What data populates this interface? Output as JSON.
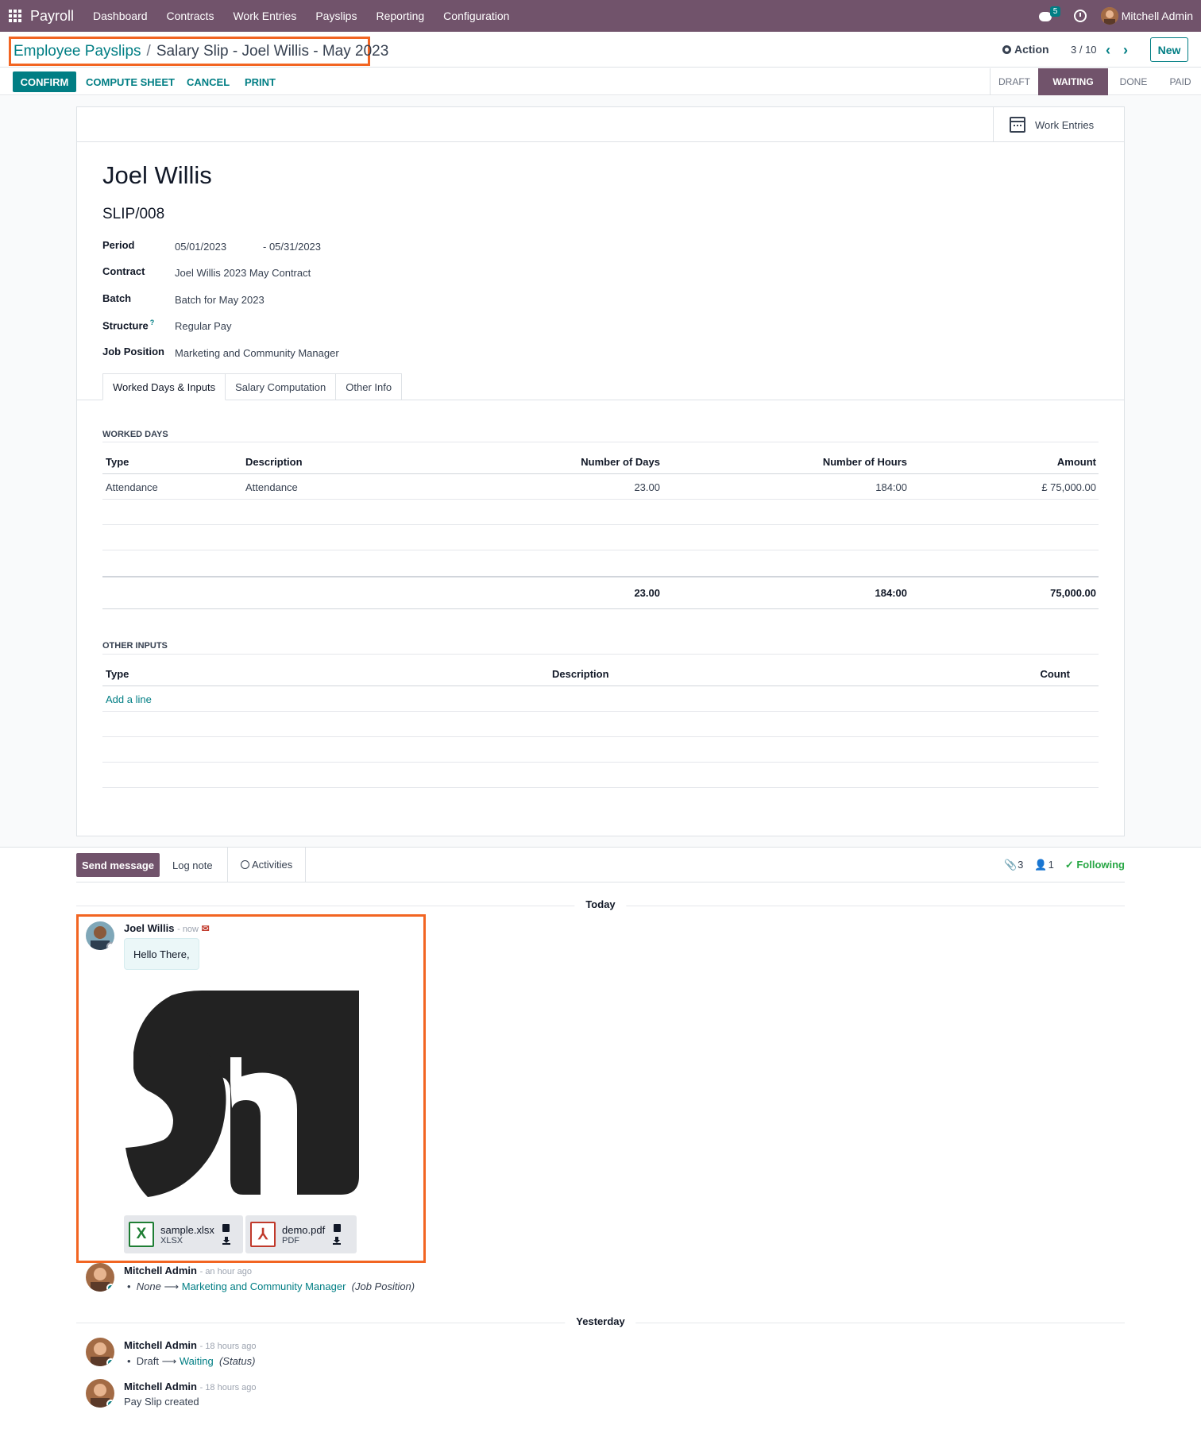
{
  "navbar": {
    "brand": "Payroll",
    "menu": [
      "Dashboard",
      "Contracts",
      "Work Entries",
      "Payslips",
      "Reporting",
      "Configuration"
    ],
    "chat_badge": "5",
    "user": "Mitchell Admin"
  },
  "control": {
    "breadcrumb_parent": "Employee Payslips",
    "breadcrumb_separator": "/",
    "breadcrumb_current": "Salary Slip - Joel Willis - May 2023",
    "action_label": "Action",
    "pager": "3 / 10",
    "new_label": "New"
  },
  "buttons": {
    "confirm": "CONFIRM",
    "compute": "COMPUTE SHEET",
    "cancel": "CANCEL",
    "print": "PRINT"
  },
  "status_steps": [
    "DRAFT",
    "WAITING",
    "DONE",
    "PAID"
  ],
  "status_active": "WAITING",
  "smart_button": "Work Entries",
  "form": {
    "employee": "Joel Willis",
    "reference": "SLIP/008",
    "period_label": "Period",
    "period_from": "05/01/2023",
    "period_to": "- 05/31/2023",
    "contract_label": "Contract",
    "contract": "Joel Willis 2023 May Contract",
    "batch_label": "Batch",
    "batch": "Batch for May 2023",
    "structure_label": "Structure",
    "structure_help": "?",
    "structure": "Regular Pay",
    "job_label": "Job Position",
    "job": "Marketing and Community Manager"
  },
  "tabs": [
    "Worked Days & Inputs",
    "Salary Computation",
    "Other Info"
  ],
  "worked_days": {
    "title": "WORKED DAYS",
    "columns": [
      "Type",
      "Description",
      "Number of Days",
      "Number of Hours",
      "Amount"
    ],
    "rows": [
      {
        "type": "Attendance",
        "description": "Attendance",
        "days": "23.00",
        "hours": "184:00",
        "amount": "£ 75,000.00"
      }
    ],
    "totals": {
      "days": "23.00",
      "hours": "184:00",
      "amount": "75,000.00"
    }
  },
  "other_inputs": {
    "title": "OTHER INPUTS",
    "columns": [
      "Type",
      "Description",
      "Count"
    ],
    "add_line": "Add a line"
  },
  "chatter": {
    "send_message": "Send message",
    "log_note": "Log note",
    "activities": "Activities",
    "attachments_count": "3",
    "followers_count": "1",
    "following": "Following"
  },
  "timeline": {
    "today": "Today",
    "yesterday": "Yesterday",
    "msg1": {
      "author": "Joel Willis",
      "when": "- now",
      "body": "Hello There,",
      "attachments": [
        {
          "name": "sample.xlsx",
          "ext": "XLSX",
          "icon": "X",
          "color": "#1e7e34"
        },
        {
          "name": "demo.pdf",
          "ext": "PDF",
          "icon": "⅄",
          "color": "#c0392b"
        }
      ]
    },
    "msg2": {
      "author": "Mitchell Admin",
      "when": "- an hour ago",
      "old": "None",
      "new": "Marketing and Community Manager",
      "field": "(Job Position)"
    },
    "msg3": {
      "author": "Mitchell Admin",
      "when": "- 18 hours ago",
      "old": "Draft",
      "new": "Waiting",
      "field": "(Status)"
    },
    "msg4": {
      "author": "Mitchell Admin",
      "when": "- 18 hours ago",
      "body": "Pay Slip created"
    }
  },
  "colors": {
    "brand": "#71536b",
    "accent": "#017e84",
    "highlight": "#f26522",
    "success": "#28a745"
  }
}
